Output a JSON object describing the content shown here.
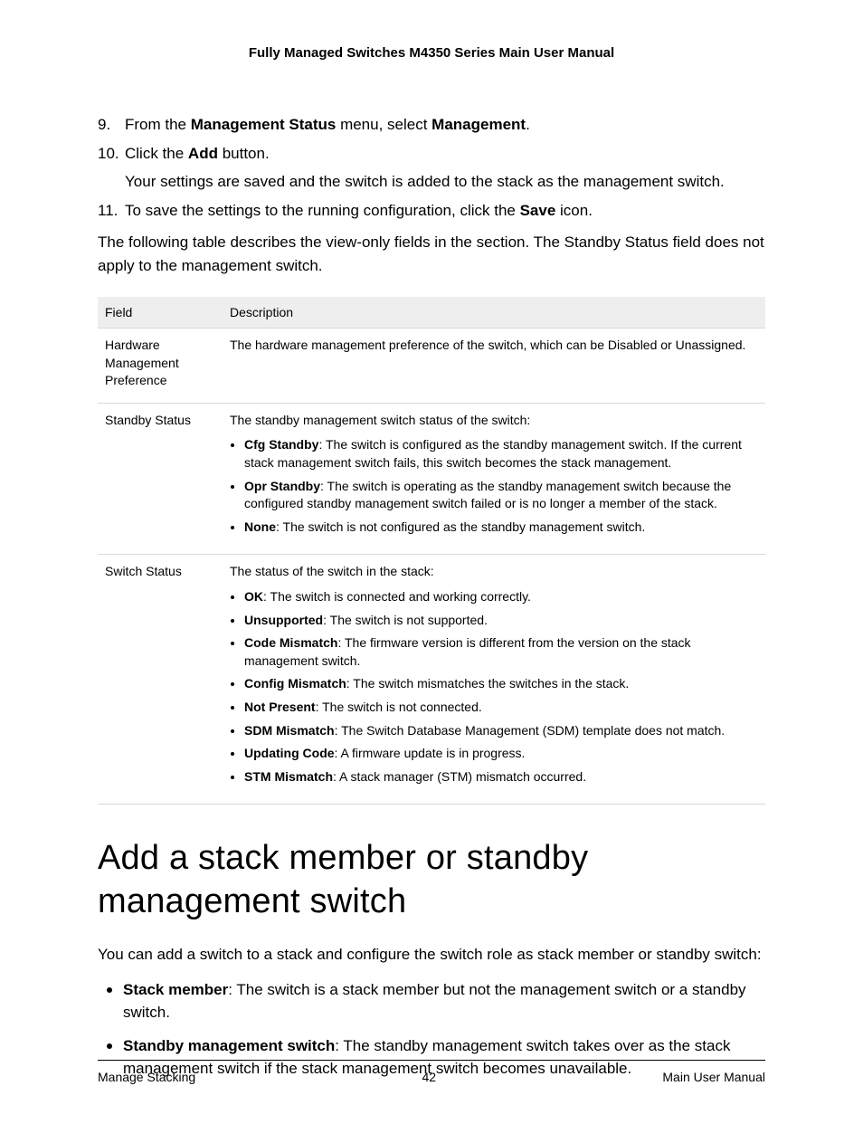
{
  "header": {
    "title": "Fully Managed Switches M4350 Series Main User Manual"
  },
  "steps": [
    {
      "num": "9.",
      "html": "From the <b>Management Status</b> menu, select <b>Management</b>."
    },
    {
      "num": "10.",
      "html": "Click the <b>Add</b> button.",
      "sub": "Your settings are saved and the switch is added to the stack as the management switch."
    },
    {
      "num": "11.",
      "html": "To save the settings to the running configuration, click the <b>Save</b> icon."
    }
  ],
  "intro": "The following table describes the view-only fields in the section. The Standby Status field does not apply to the management switch.",
  "table": {
    "headers": {
      "field": "Field",
      "desc": "Description"
    },
    "rows": [
      {
        "field": "Hardware Management Preference",
        "desc_intro": "The hardware management preference of the switch, which can be Disabled or Unassigned.",
        "bullets": []
      },
      {
        "field": "Standby Status",
        "desc_intro": "The standby management switch status of the switch:",
        "bullets": [
          "<b>Cfg Standby</b>: The switch is configured as the standby management switch. If the current stack management switch fails, this switch becomes the stack management.",
          "<b>Opr Standby</b>: The switch is operating as the standby management switch because the configured standby management switch failed or is no longer a member of the stack.",
          "<b>None</b>: The switch is not configured as the standby management switch."
        ]
      },
      {
        "field": "Switch Status",
        "desc_intro": "The status of the switch in the stack:",
        "bullets": [
          "<b>OK</b>: The switch is connected and working correctly.",
          "<b>Unsupported</b>: The switch is not supported.",
          "<b>Code Mismatch</b>: The firmware version is different from the version on the stack management switch.",
          "<b>Config Mismatch</b>: The switch mismatches the switches in the stack.",
          "<b>Not Present</b>: The switch is not connected.",
          "<b>SDM Mismatch</b>: The Switch Database Management (SDM) template does not match.",
          "<b>Updating Code</b>: A firmware update is in progress.",
          "<b>STM Mismatch</b>: A stack manager (STM) mismatch occurred."
        ]
      }
    ]
  },
  "section_title": "Add a stack member or standby management switch",
  "section_body": "You can add a switch to a stack and configure the switch role as stack member or standby switch:",
  "section_list": [
    "<b>Stack member</b>: The switch is a stack member but not the management switch or a standby switch.",
    "<b>Standby management switch</b>: The standby management switch takes over as the stack management switch if the stack management switch becomes unavailable."
  ],
  "footer": {
    "left": "Manage Stacking",
    "center": "42",
    "right": "Main User Manual"
  }
}
